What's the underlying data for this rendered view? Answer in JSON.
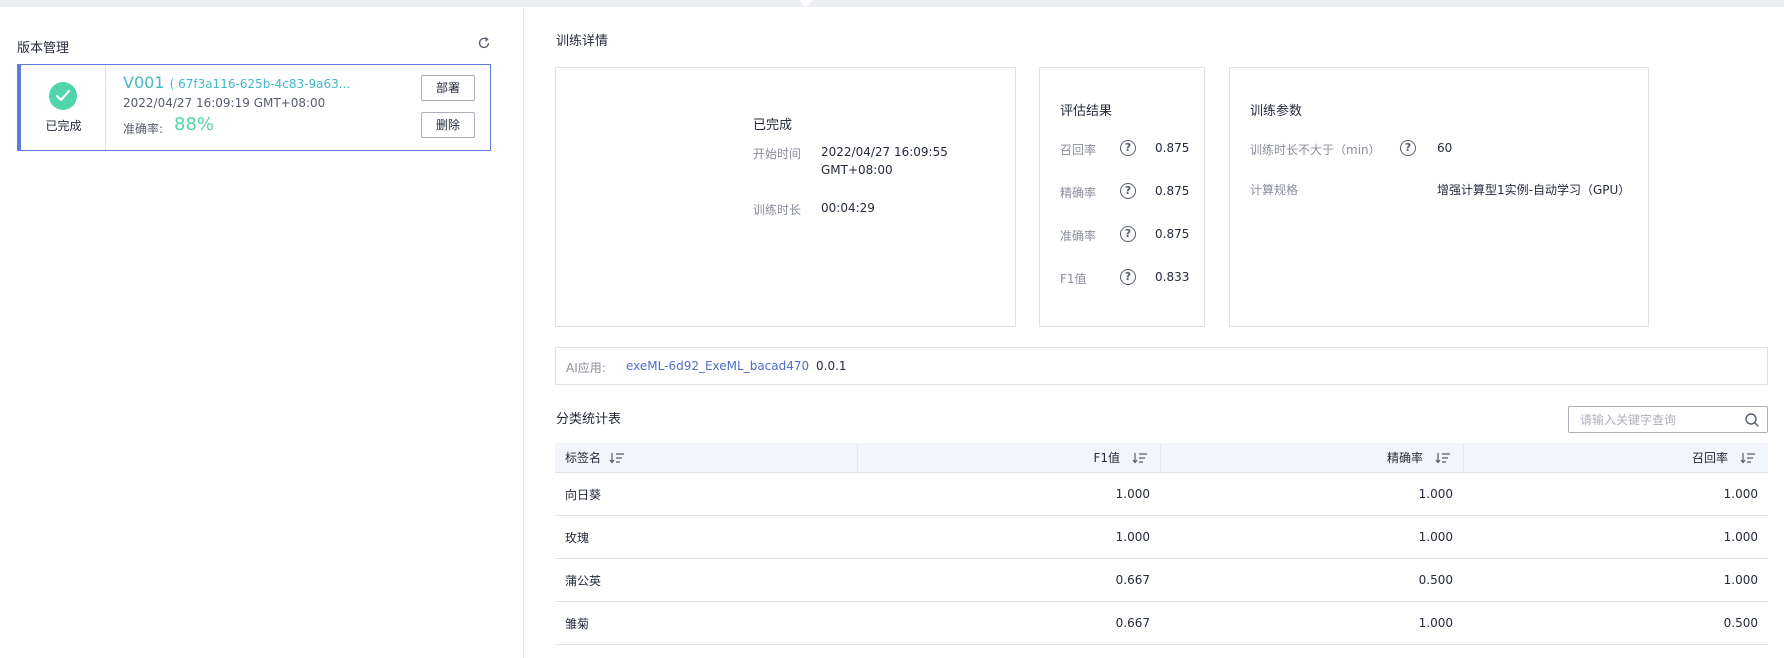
{
  "left_panel": {
    "title": "版本管理",
    "version_card": {
      "status": "已完成",
      "version": "V001",
      "job_id": "( 67f3a116-625b-4c83-9a63...",
      "created_time": "2022/04/27 16:09:19 GMT+08:00",
      "accuracy_label": "准确率:",
      "accuracy_value": "88%",
      "deploy_label": "部署",
      "delete_label": "删除"
    }
  },
  "training_details": {
    "title": "训练详情",
    "status_box": {
      "status": "已完成",
      "start_time_label": "开始时间",
      "start_time_line1": "2022/04/27 16:09:55",
      "start_time_line2": "GMT+08:00",
      "duration_label": "训练时长",
      "duration_value": "00:04:29"
    },
    "evaluation": {
      "title": "评估结果",
      "metrics": [
        {
          "label": "召回率",
          "value": "0.875"
        },
        {
          "label": "精确率",
          "value": "0.875"
        },
        {
          "label": "准确率",
          "value": "0.875"
        },
        {
          "label": "F1值",
          "value": "0.833"
        }
      ]
    },
    "params": {
      "title": "训练参数",
      "max_duration_label": "训练时长不大于（min）",
      "max_duration_value": "60",
      "spec_label": "计算规格",
      "spec_value": "增强计算型1实例-自动学习（GPU）"
    },
    "ai_app": {
      "label": "AI应用:",
      "name": "exeML-6d92_ExeML_bacad470",
      "version": "0.0.1"
    }
  },
  "stats_table": {
    "title": "分类统计表",
    "search_placeholder": "请输入关键字查询",
    "headers": [
      "标签名",
      "F1值",
      "精确率",
      "召回率"
    ],
    "rows": [
      [
        "向日葵",
        "1.000",
        "1.000",
        "1.000"
      ],
      [
        "玫瑰",
        "1.000",
        "1.000",
        "1.000"
      ],
      [
        "蒲公英",
        "0.667",
        "0.500",
        "1.000"
      ],
      [
        "雏菊",
        "0.667",
        "1.000",
        "0.500"
      ]
    ]
  },
  "colors": {
    "accent": "#5e7ce0",
    "success": "#50d4ab",
    "link": "#526ecc",
    "version_text": "#3fb9c6"
  }
}
